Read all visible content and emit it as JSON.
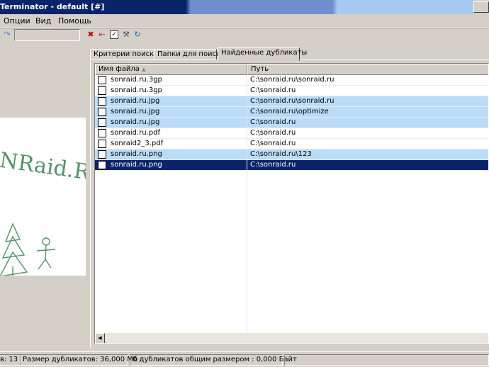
{
  "window": {
    "title": "Terminator - default [#]"
  },
  "menu": {
    "items": [
      "Опции",
      "Вид",
      "Помощь"
    ]
  },
  "toolbar": {
    "search_value": ""
  },
  "tabs": [
    {
      "label": "Критерии поиска",
      "active": false
    },
    {
      "label": "Папки для поиска",
      "active": false
    },
    {
      "label": "Найденные дубликаты",
      "active": true
    }
  ],
  "list": {
    "columns": {
      "name": "Имя файла",
      "path": "Путь"
    },
    "rows": [
      {
        "name": "sonraid.ru.3gp",
        "path": "C:\\sonraid.ru\\sonraid.ru",
        "state": "normal"
      },
      {
        "name": "sonraid.ru.3gp",
        "path": "C:\\sonraid.ru",
        "state": "normal"
      },
      {
        "name": "sonraid.ru.jpg",
        "path": "C:\\sonraid.ru\\sonraid.ru",
        "state": "highlight"
      },
      {
        "name": "sonraid.ru.jpg",
        "path": "C:\\sonraid.ru\\optimize",
        "state": "highlight"
      },
      {
        "name": "sonraid.ru.jpg",
        "path": "C:\\sonraid.ru",
        "state": "highlight"
      },
      {
        "name": "sonraid.ru.pdf",
        "path": "C:\\sonraid.ru",
        "state": "normal"
      },
      {
        "name": "sonraid2_3.pdf",
        "path": "C:\\sonraid.ru",
        "state": "normal"
      },
      {
        "name": "sonraid.ru.png",
        "path": "C:\\sonraid.ru\\123",
        "state": "highlight"
      },
      {
        "name": "sonraid.ru.png",
        "path": "C:\\sonraid.ru",
        "state": "selected"
      }
    ]
  },
  "preview": {
    "image_text": "NRaid.Ru"
  },
  "status": {
    "count": "в: 13",
    "dup_size": "Размер дубликатов: 36,000 Мб",
    "summary": "0 дубликатов общим размером : 0,000 Байт"
  },
  "colors": {
    "highlight": "#b9dcf9",
    "selected": "#0a246a",
    "title_bar": "#0a246a"
  }
}
